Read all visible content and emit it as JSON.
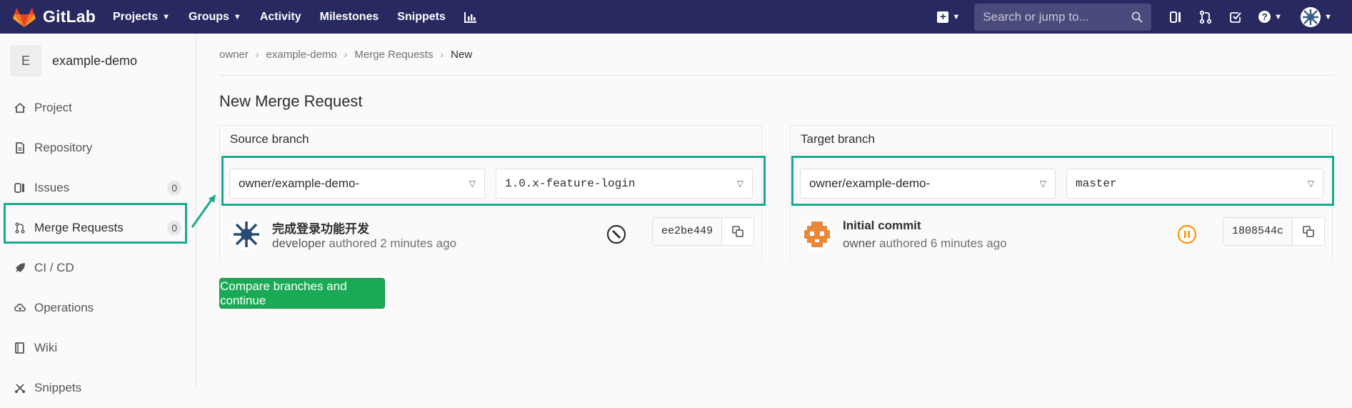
{
  "topbar": {
    "brand": "GitLab",
    "nav": [
      {
        "label": "Projects",
        "caret": true
      },
      {
        "label": "Groups",
        "caret": true
      },
      {
        "label": "Activity",
        "caret": false
      },
      {
        "label": "Milestones",
        "caret": false
      },
      {
        "label": "Snippets",
        "caret": false
      }
    ],
    "search_placeholder": "Search or jump to..."
  },
  "sidebar": {
    "project_initial": "E",
    "project_name": "example-demo",
    "items": [
      {
        "label": "Project",
        "icon": "home-icon"
      },
      {
        "label": "Repository",
        "icon": "document-icon"
      },
      {
        "label": "Issues",
        "icon": "issues-icon",
        "badge": "0"
      },
      {
        "label": "Merge Requests",
        "icon": "merge-request-icon",
        "badge": "0"
      },
      {
        "label": "CI / CD",
        "icon": "rocket-icon"
      },
      {
        "label": "Operations",
        "icon": "cloud-gear-icon"
      },
      {
        "label": "Wiki",
        "icon": "book-icon"
      },
      {
        "label": "Snippets",
        "icon": "snippet-icon"
      }
    ]
  },
  "breadcrumb": [
    "owner",
    "example-demo",
    "Merge Requests",
    "New"
  ],
  "page_title": "New Merge Request",
  "source": {
    "header": "Source branch",
    "project": "owner/example-demo-",
    "branch": "1.0.x-feature-login",
    "commit": {
      "title": "完成登录功能开发",
      "author": "developer",
      "time_text": "authored 2 minutes ago",
      "sha": "ee2be449",
      "status": "canceled"
    }
  },
  "target": {
    "header": "Target branch",
    "project": "owner/example-demo-",
    "branch": "master",
    "commit": {
      "title": "Initial commit",
      "author": "owner",
      "time_text": "authored 6 minutes ago",
      "sha": "1808544c",
      "status": "paused"
    }
  },
  "compare_button": "Compare branches and continue",
  "colors": {
    "topbar": "#292961",
    "highlight": "#1aaa8e",
    "primary_button": "#1aaa55",
    "paused": "#fc9403"
  }
}
